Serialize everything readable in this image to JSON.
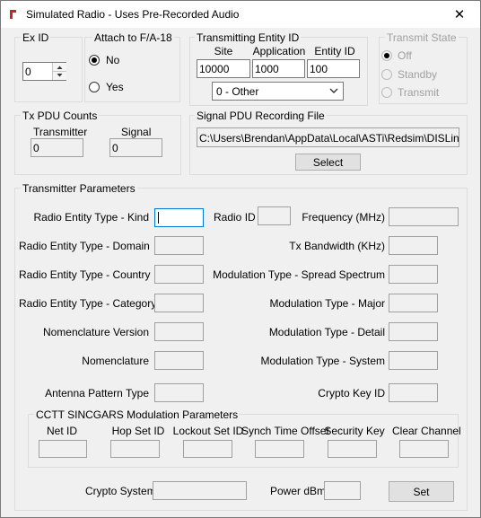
{
  "window": {
    "title": "Simulated Radio - Uses Pre-Recorded Audio"
  },
  "ex_id": {
    "group_label": "Ex ID",
    "value": "0"
  },
  "attach": {
    "group_label": "Attach to F/A-18",
    "no_label": "No",
    "yes_label": "Yes",
    "selected": "No"
  },
  "entity": {
    "group_label": "Transmitting Entity ID",
    "site_label": "Site",
    "site_value": "10000",
    "app_label": "Application",
    "app_value": "1000",
    "entity_label": "Entity ID",
    "entity_value": "100",
    "dropdown_value": "0 - Other"
  },
  "transmit_state": {
    "group_label": "Transmit State",
    "off_label": "Off",
    "standby_label": "Standby",
    "transmit_label": "Transmit",
    "selected": "Off"
  },
  "tx_pdu": {
    "group_label": "Tx PDU Counts",
    "transmitter_label": "Transmitter",
    "transmitter_value": "0",
    "signal_label": "Signal",
    "signal_value": "0"
  },
  "signal_file": {
    "group_label": "Signal PDU Recording File",
    "path": "C:\\Users\\Brendan\\AppData\\Local\\ASTi\\Redsim\\DISLinkM",
    "select_label": "Select"
  },
  "tx_params": {
    "group_label": "Transmitter Parameters",
    "labels": {
      "kind": "Radio Entity Type - Kind",
      "radio_id": "Radio ID",
      "frequency": "Frequency (MHz)",
      "domain": "Radio Entity Type - Domain",
      "bandwidth": "Tx Bandwidth (KHz)",
      "country": "Radio Entity Type - Country",
      "spread": "Modulation Type - Spread Spectrum",
      "category": "Radio Entity Type - Category",
      "major": "Modulation Type - Major",
      "nom_version": "Nomenclature Version",
      "detail": "Modulation Type - Detail",
      "nomenclature": "Nomenclature",
      "system": "Modulation Type - System",
      "antenna": "Antenna Pattern Type",
      "crypto_key": "Crypto Key ID"
    }
  },
  "sincgars": {
    "group_label": "CCTT SINCGARS Modulation Parameters",
    "net_id": "Net ID",
    "hop_set": "Hop Set ID",
    "lockout": "Lockout Set ID",
    "sync_time": "Synch Time Offset",
    "security_key": "Security Key",
    "clear_channel": "Clear Channel"
  },
  "bottom": {
    "crypto_label": "Crypto System",
    "power_label": "Power dBm",
    "set_label": "Set"
  }
}
